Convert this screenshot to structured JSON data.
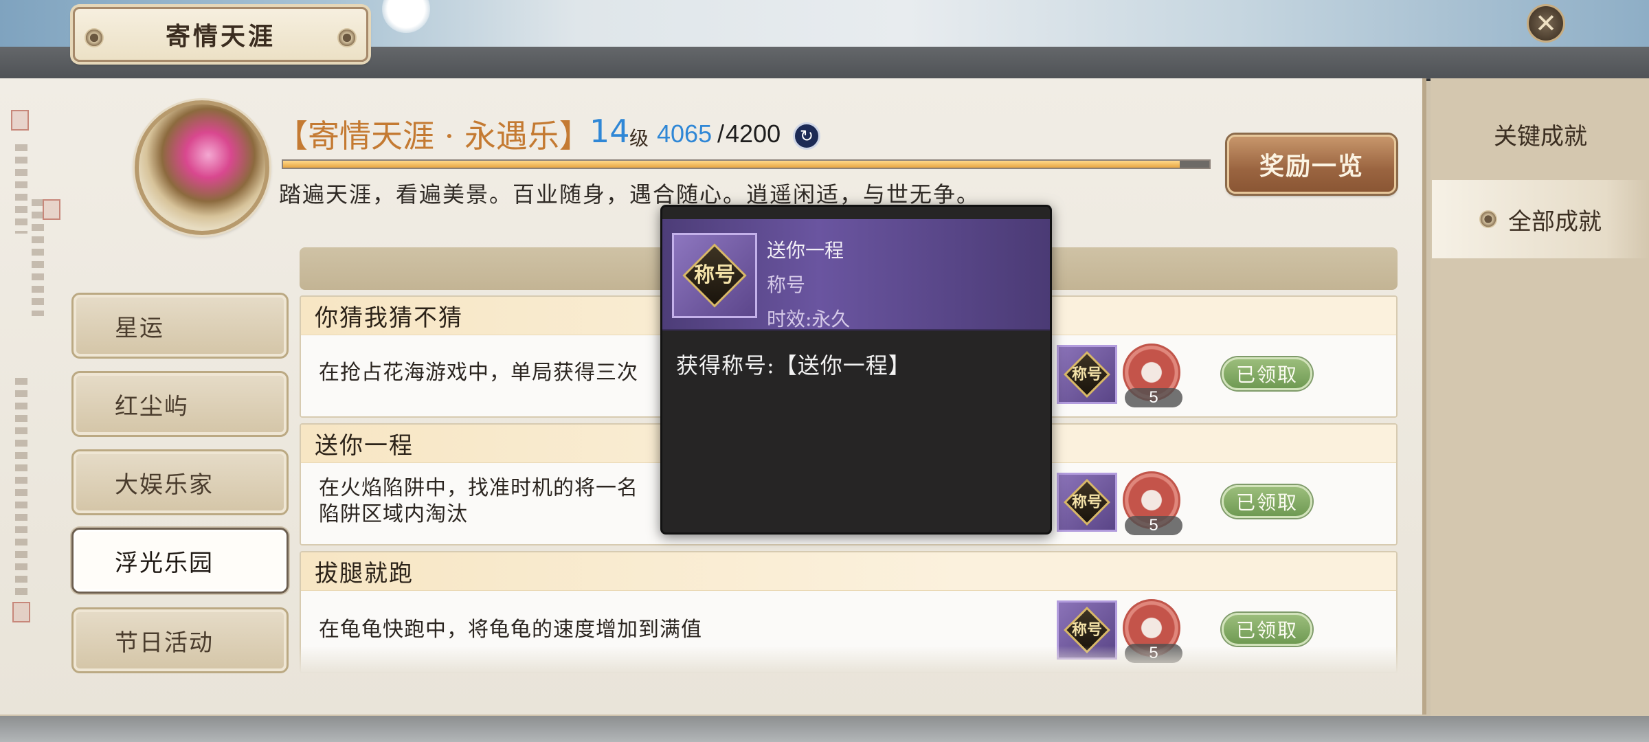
{
  "window": {
    "title": "寄情天涯"
  },
  "achievement_header": {
    "name": "【寄情天涯 · 永遇乐】",
    "level": "14",
    "level_unit": "级",
    "progress_current": "4065",
    "progress_separator": "/",
    "progress_max": "4200",
    "progress_fraction": 0.968,
    "description": "踏遍天涯，看遍美景。百业随身，遇合随心。逍遥闲适，与世无争。",
    "reward_button": "奖励一览"
  },
  "right_tabs": [
    {
      "label": "关键成就"
    },
    {
      "label": "全部成就"
    }
  ],
  "left_nav": [
    {
      "label": "星运"
    },
    {
      "label": "红尘屿"
    },
    {
      "label": "大娱乐家"
    },
    {
      "label": "浮光乐园"
    },
    {
      "label": "节日活动"
    }
  ],
  "entries": [
    {
      "title": "你猜我猜不猜",
      "desc_line1": "在抢占花海游戏中，单局获得三次",
      "desc_line2": "",
      "title_icon_text": "称号",
      "coin_count": "5",
      "status": "已领取"
    },
    {
      "title": "送你一程",
      "desc_line1": "在火焰陷阱中，找准时机的将一名",
      "desc_line2": "陷阱区域内淘汰",
      "title_icon_text": "称号",
      "coin_count": "5",
      "status": "已领取"
    },
    {
      "title": "拔腿就跑",
      "desc_line1": "在龟龟快跑中，将龟龟的速度增加到满值",
      "desc_line2": "",
      "title_icon_text": "称号",
      "coin_count": "5",
      "status": "已领取"
    }
  ],
  "tooltip": {
    "icon_text": "称号",
    "name": "送你一程",
    "type": "称号",
    "duration": "时效:永久",
    "description": "获得称号:【送你一程】"
  },
  "icons": {
    "close": "close-icon",
    "refresh": "refresh-icon",
    "coin": "achievement-coin-icon",
    "title_badge": "title-badge-icon"
  },
  "colors": {
    "accent_orange": "#c47a32",
    "level_blue": "#2f87d6",
    "tooltip_purple": "#5c468b",
    "claimed_green": "#7ea65f"
  }
}
